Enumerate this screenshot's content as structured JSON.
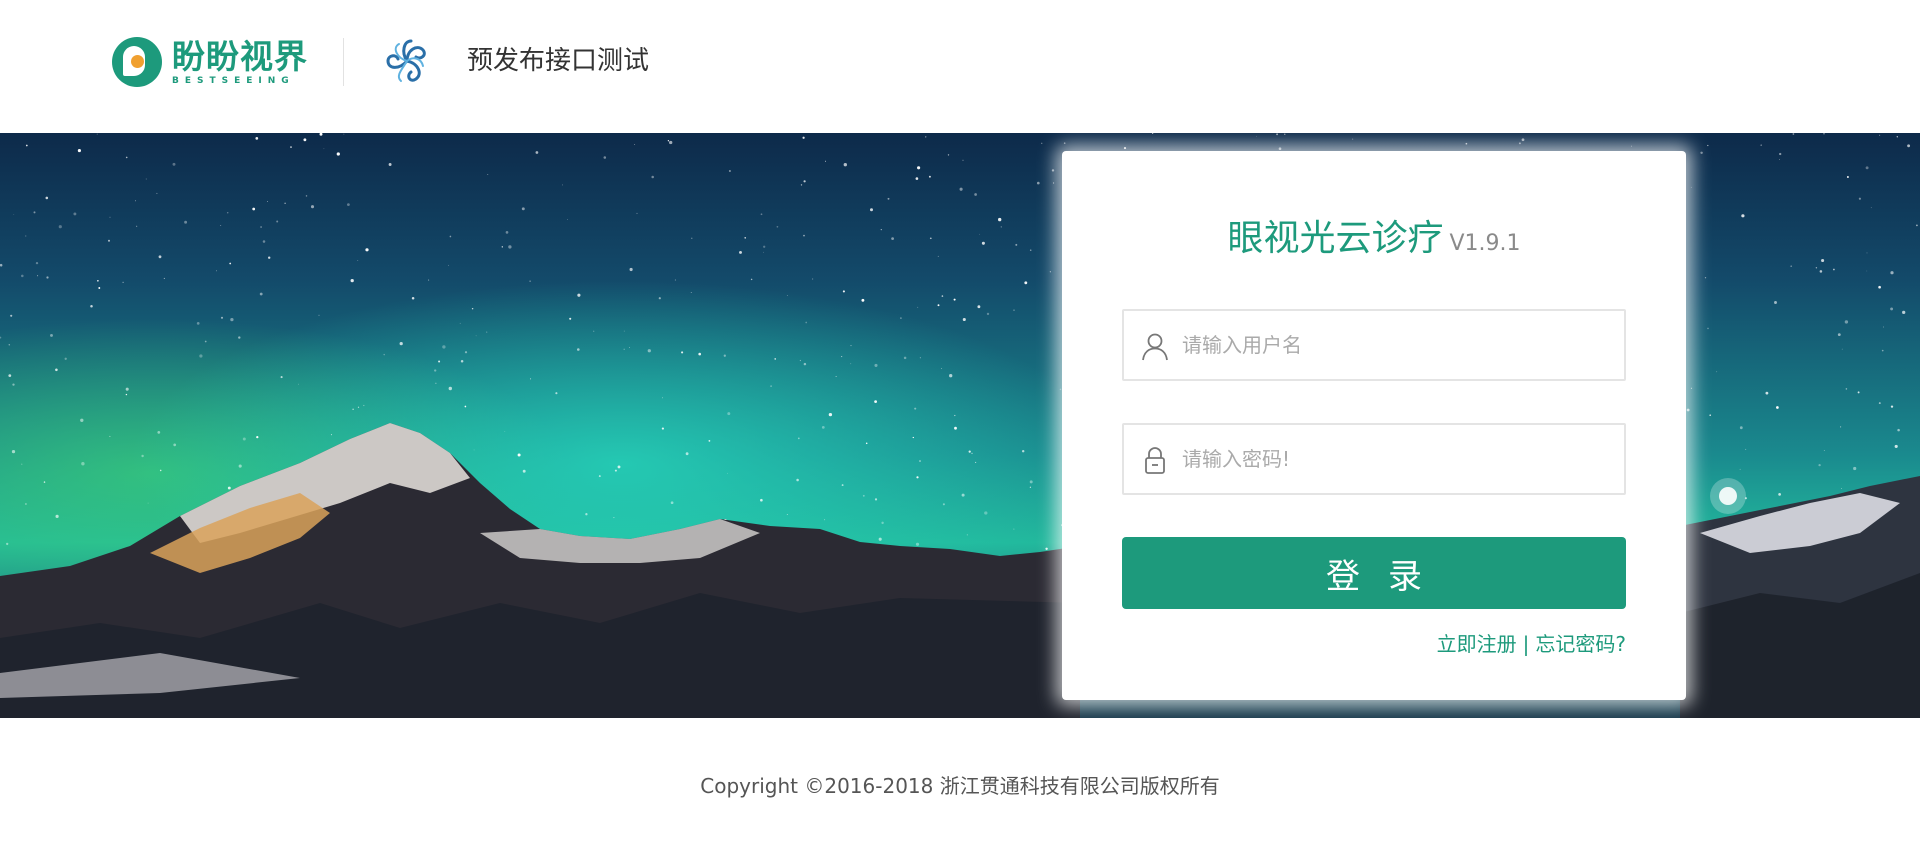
{
  "header": {
    "brand": {
      "name_cn": "盼盼视界",
      "name_en": "BESTSEEING",
      "icon": "bestseeing-logo-icon"
    },
    "partner_logo": {
      "icon": "swirl-logo-icon"
    },
    "site_title": "预发布接口测试"
  },
  "login": {
    "title": "眼视光云诊疗",
    "version": "V1.9.1",
    "username": {
      "value": "",
      "placeholder": "请输入用户名",
      "icon": "user-icon"
    },
    "password": {
      "value": "",
      "placeholder": "请输入密码!",
      "icon": "lock-icon"
    },
    "submit_label": "登录",
    "register_link": "立即注册",
    "separator": "|",
    "forgot_link": "忘记密码?"
  },
  "footer": {
    "copyright": "Copyright ©2016-2018 浙江贯通科技有限公司版权所有"
  },
  "colors": {
    "brand_green": "#1d9a7c",
    "text_dark": "#333333",
    "placeholder": "#aaaaaa"
  }
}
